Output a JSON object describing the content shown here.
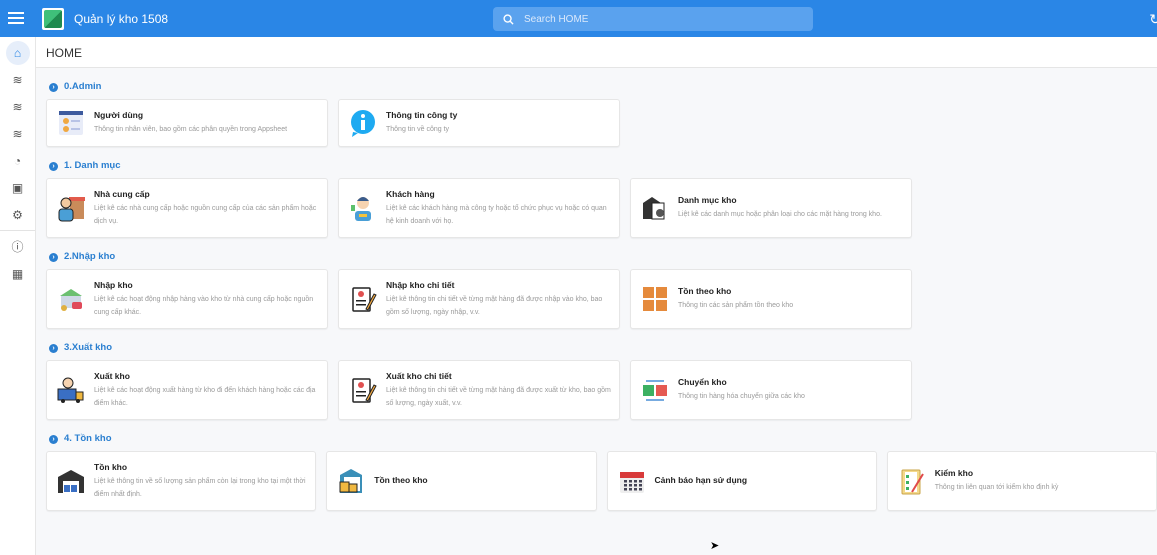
{
  "app": {
    "title": "Quản lý kho 1508",
    "search_placeholder": "Search HOME"
  },
  "header": {
    "title": "HOME"
  },
  "sections": [
    {
      "title": "0.Admin",
      "cards": [
        {
          "title": "Người dùng",
          "desc": "Thông tin nhân viên, bao gồm các phân quyền trong Appsheet",
          "icon": "users-list-icon"
        },
        {
          "title": "Thông tin công ty",
          "desc": "Thông tin về công ty",
          "icon": "info-icon"
        }
      ]
    },
    {
      "title": "1. Danh mục",
      "cards": [
        {
          "title": "Nhà cung cấp",
          "desc": "Liệt kê các nhà cung cấp hoặc nguồn cung cấp của các sản phẩm hoặc dịch vụ.",
          "icon": "supplier-icon"
        },
        {
          "title": "Khách hàng",
          "desc": "Liệt kê các khách hàng mà công ty hoặc tổ chức phục vụ hoặc có quan hệ kinh doanh với họ.",
          "icon": "customer-icon"
        },
        {
          "title": "Danh mục kho",
          "desc": "Liệt kê các danh mục hoặc phân loại cho các mặt hàng trong kho.",
          "icon": "warehouse-catalog-icon"
        }
      ]
    },
    {
      "title": "2.Nhập kho",
      "cards": [
        {
          "title": "Nhập kho",
          "desc": "Liệt kê các hoạt động nhập hàng vào kho từ nhà cung cấp hoặc nguồn cung cấp khác.",
          "icon": "import-icon"
        },
        {
          "title": "Nhập kho chi tiết",
          "desc": "Liệt kê thông tin chi tiết về từng mặt hàng đã được nhập vào kho, bao gồm số lượng, ngày nhập, v.v.",
          "icon": "document-edit-icon"
        },
        {
          "title": "Tồn theo kho",
          "desc": "Thông tin các sản phẩm tồn theo kho",
          "icon": "boxes-icon"
        }
      ]
    },
    {
      "title": "3.Xuất kho",
      "cards": [
        {
          "title": "Xuất kho",
          "desc": "Liệt kê các hoạt động xuất hàng từ kho đi đến khách hàng hoặc các địa điểm khác.",
          "icon": "truck-icon"
        },
        {
          "title": "Xuất kho chi tiết",
          "desc": "Liệt kê thông tin chi tiết về từng mặt hàng đã được xuất từ kho, bao gồm số lượng, ngày xuất, v.v.",
          "icon": "document-edit-icon"
        },
        {
          "title": "Chuyển kho",
          "desc": "Thông tin hàng hóa chuyển giữa các kho",
          "icon": "transfer-icon"
        }
      ]
    },
    {
      "title": "4. Tồn kho",
      "cards": [
        {
          "title": "Tồn kho",
          "desc": "Liệt kê thông tin về số lượng sản phẩm còn lại trong kho tại một thời điểm nhất định.",
          "icon": "warehouse-icon"
        },
        {
          "title": "Tồn theo kho",
          "desc": "",
          "icon": "warehouse-boxes-icon"
        },
        {
          "title": "Cảnh báo hạn sử dụng",
          "desc": "",
          "icon": "calendar-icon"
        },
        {
          "title": "Kiểm kho",
          "desc": "Thông tin liên quan tới kiểm kho định kỳ",
          "icon": "checklist-icon"
        }
      ]
    }
  ]
}
